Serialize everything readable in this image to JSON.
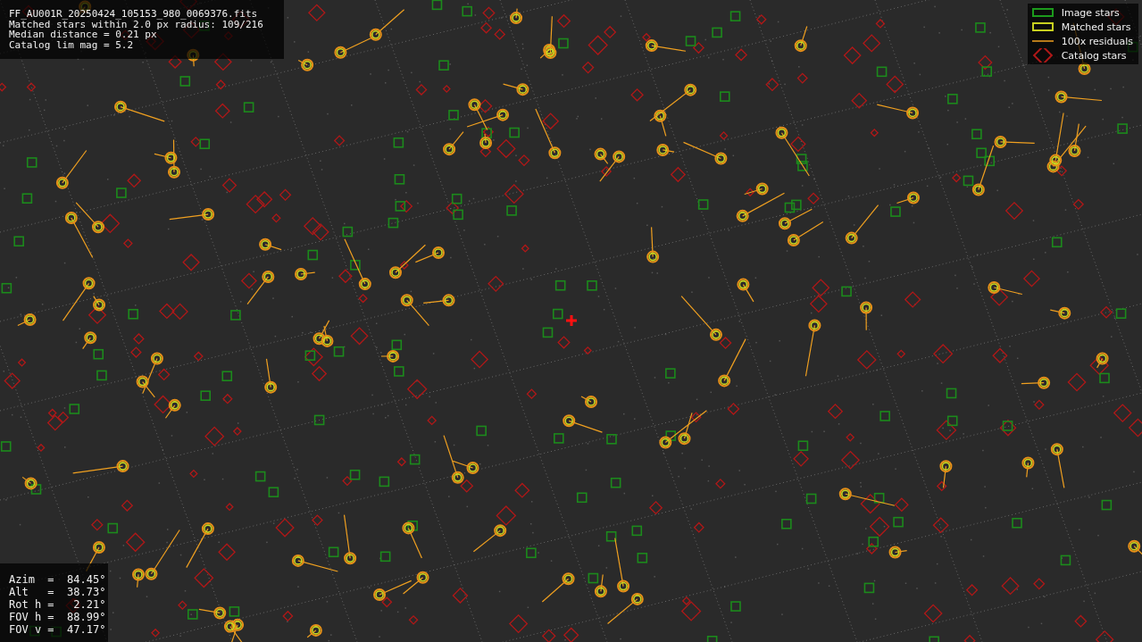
{
  "header": {
    "lines": [
      "FF_AU001R_20250424_105153_980_0069376.fits",
      "Matched stars within 2.0 px radius: 109/216",
      "Median distance = 0.21 px",
      "Catalog lim mag = 5.2"
    ]
  },
  "fov_info": {
    "lines": [
      "Azim  =  84.45°",
      "Alt   =  38.73°",
      "Rot h =   2.21°",
      "FOV h =  88.99°",
      "FOV v =  47.17°"
    ]
  },
  "legend": {
    "items": [
      {
        "kind": "image",
        "label": "Image stars"
      },
      {
        "kind": "matched",
        "label": "Matched stars"
      },
      {
        "kind": "residual",
        "label": "100x residuals"
      },
      {
        "kind": "catalog",
        "label": "Catalog stars"
      }
    ]
  }
}
